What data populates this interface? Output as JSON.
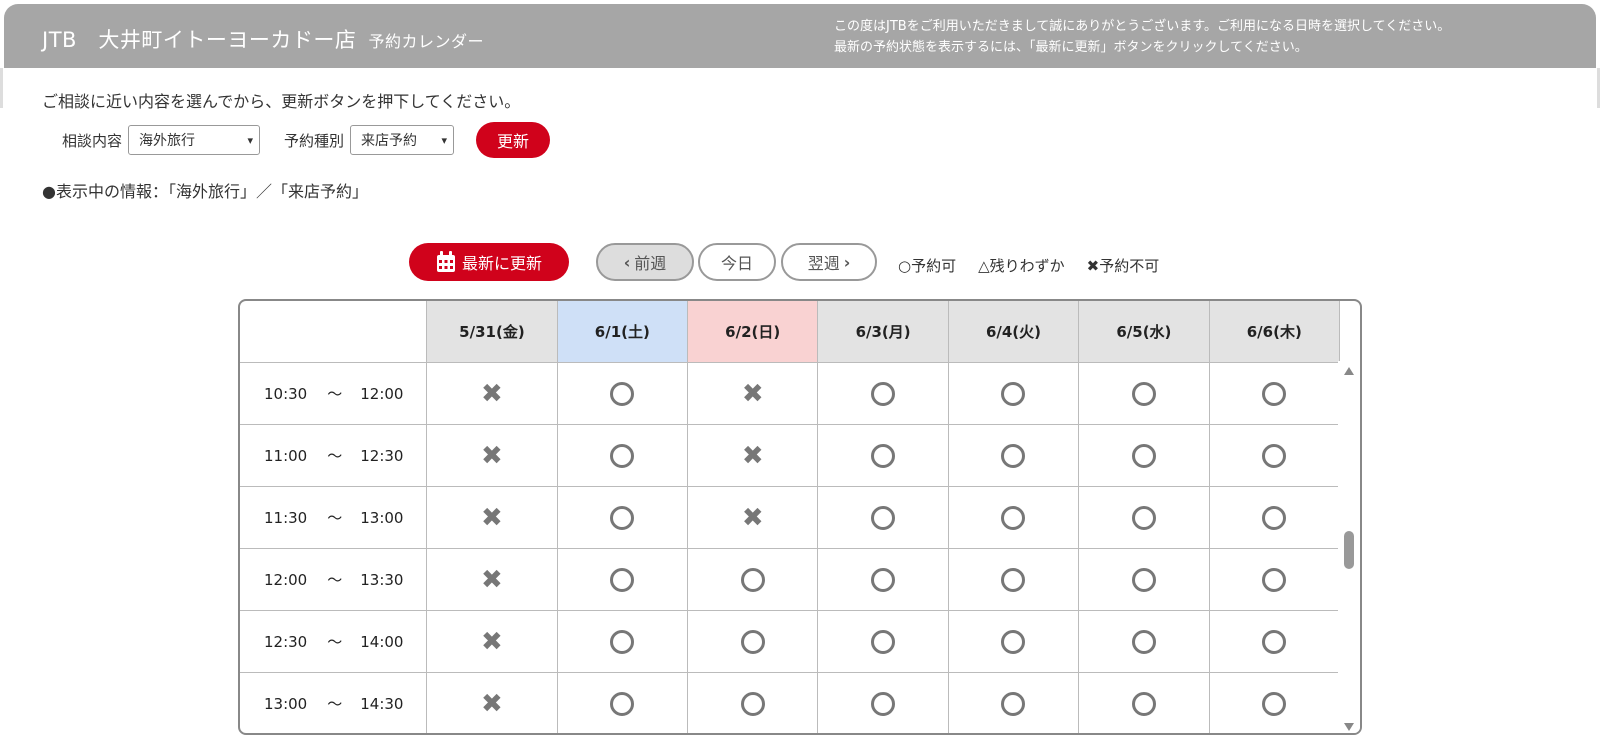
{
  "header": {
    "brand": "JTB　大井町イトーヨーカドー店",
    "subtitle": "予約カレンダー",
    "notice_line1": "この度はJTBをご利用いただきまして誠にありがとうございます。ご利用になる日時を選択してください。",
    "notice_line2": "最新の予約状態を表示するには、「最新に更新」ボタンをクリックしてください。"
  },
  "form": {
    "guide": "ご相談に近い内容を選んでから、更新ボタンを押下してください。",
    "consult_label": "相談内容",
    "consult_value": "海外旅行",
    "type_label": "予約種別",
    "type_value": "来店予約",
    "update_label": "更新",
    "info": "●表示中の情報：「海外旅行」／「来店予約」"
  },
  "toolbar": {
    "refresh_label": "最新に更新",
    "prev_label": "前週",
    "today_label": "今日",
    "next_label": "翌週",
    "legend_ok": "○予約可",
    "legend_few": "△残りわずか",
    "legend_full": "✖予約不可"
  },
  "calendar": {
    "days": [
      "5/31(金)",
      "6/1(土)",
      "6/2(日)",
      "6/3(月)",
      "6/4(火)",
      "6/5(水)",
      "6/6(木)"
    ],
    "slots": [
      {
        "start": "10:30",
        "end": "12:00",
        "status": [
          "x",
          "o",
          "x",
          "o",
          "o",
          "o",
          "o"
        ]
      },
      {
        "start": "11:00",
        "end": "12:30",
        "status": [
          "x",
          "o",
          "x",
          "o",
          "o",
          "o",
          "o"
        ]
      },
      {
        "start": "11:30",
        "end": "13:00",
        "status": [
          "x",
          "o",
          "x",
          "o",
          "o",
          "o",
          "o"
        ]
      },
      {
        "start": "12:00",
        "end": "13:30",
        "status": [
          "x",
          "o",
          "o",
          "o",
          "o",
          "o",
          "o"
        ]
      },
      {
        "start": "12:30",
        "end": "14:00",
        "status": [
          "x",
          "o",
          "o",
          "o",
          "o",
          "o",
          "o"
        ]
      },
      {
        "start": "13:00",
        "end": "14:30",
        "status": [
          "x",
          "o",
          "o",
          "o",
          "o",
          "o",
          "o"
        ]
      }
    ],
    "tilde": "～"
  },
  "colors": {
    "accent": "#d0021b",
    "header_bg": "#a6a6a6",
    "sat_bg": "#cfe0f7",
    "sun_bg": "#f9d2d2"
  }
}
